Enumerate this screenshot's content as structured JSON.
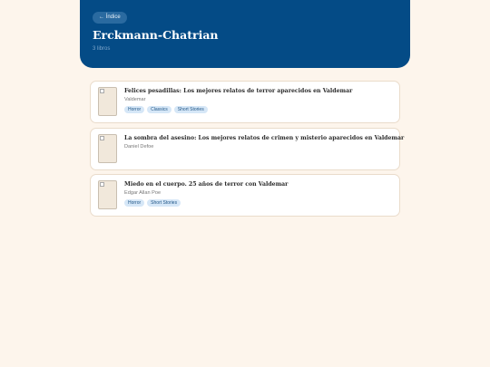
{
  "header": {
    "back_label": "← Índice",
    "title": "Erckmann-Chatrian",
    "subtitle": "3 libros"
  },
  "colors": {
    "header_bg": "#044b86",
    "page_bg": "#fdf5ec",
    "tag_bg": "#d6e7f7",
    "tag_text": "#1f5586"
  },
  "books": [
    {
      "title": "Felices pesadillas: Los mejores relatos de terror aparecidos en Valdemar",
      "author": "Valdemar",
      "tags": [
        "Horror",
        "Classics",
        "Short Stories"
      ]
    },
    {
      "title": "La sombra del asesino: Los mejores relatos de crimen y misterio aparecidos en Valdemar",
      "author": "Daniel Defoe",
      "tags": []
    },
    {
      "title": "Miedo en el cuerpo. 25 años de terror con Valdemar",
      "author": "Edgar Allan Poe",
      "tags": [
        "Horror",
        "Short Stories"
      ]
    }
  ]
}
